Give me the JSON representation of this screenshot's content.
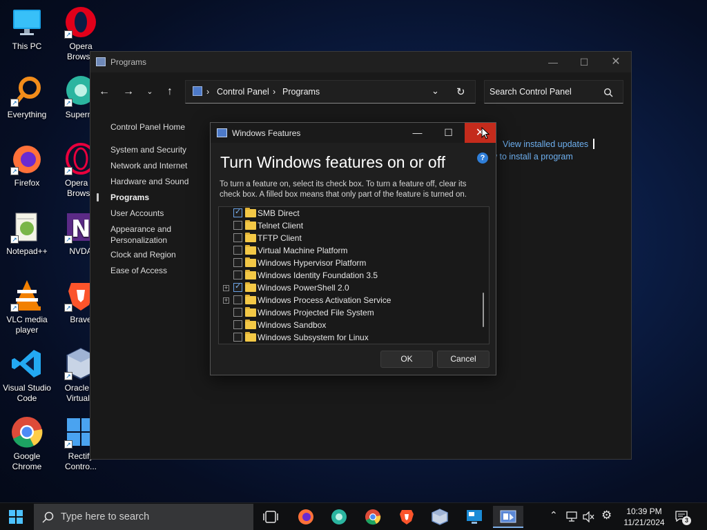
{
  "desktop": {
    "icons": [
      {
        "label": "This PC",
        "icon": "monitor-icon"
      },
      {
        "label": "Opera\nBrowse",
        "icon": "opera-icon"
      },
      {
        "label": "Everything",
        "icon": "magnifier-icon"
      },
      {
        "label": "Supermi",
        "icon": "supermium-icon"
      },
      {
        "label": "Firefox",
        "icon": "firefox-icon"
      },
      {
        "label": "Opera G\nBrowse",
        "icon": "opera-gx-icon"
      },
      {
        "label": "Notepad++",
        "icon": "notepadpp-icon"
      },
      {
        "label": "NVDA",
        "icon": "nvda-icon"
      },
      {
        "label": "VLC media\nplayer",
        "icon": "vlc-icon"
      },
      {
        "label": "Brave",
        "icon": "brave-icon"
      },
      {
        "label": "Visual Studio\nCode",
        "icon": "vscode-icon"
      },
      {
        "label": "Oracle V\nVirtualB",
        "icon": "virtualbox-icon"
      },
      {
        "label": "Google\nChrome",
        "icon": "chrome-icon"
      },
      {
        "label": "Rectify\nContro...",
        "icon": "rectify-icon"
      }
    ]
  },
  "control_panel": {
    "window_title": "Programs",
    "address": {
      "root": "Control Panel",
      "current": "Programs",
      "separator": "›"
    },
    "search_placeholder": "Search Control Panel",
    "sidebar": {
      "home": "Control Panel Home",
      "items": [
        "System and Security",
        "Network and Internet",
        "Hardware and Sound",
        "Programs",
        "User Accounts",
        "Appearance and\nPersonalization",
        "Clock and Region",
        "Ease of Access"
      ],
      "selected": "Programs"
    },
    "links": {
      "view_updates": "View installed updates",
      "install_program": "w to install a program"
    }
  },
  "windows_features": {
    "title": "Windows Features",
    "heading": "Turn Windows features on or off",
    "help": "?",
    "description": "To turn a feature on, select its check box. To turn a feature off, clear its check box. A filled box means that only part of the feature is turned on.",
    "features": [
      {
        "label": "SMB Direct",
        "checked": true,
        "expandable": false
      },
      {
        "label": "Telnet Client",
        "checked": false,
        "expandable": false
      },
      {
        "label": "TFTP Client",
        "checked": false,
        "expandable": false
      },
      {
        "label": "Virtual Machine Platform",
        "checked": false,
        "expandable": false
      },
      {
        "label": "Windows Hypervisor Platform",
        "checked": false,
        "expandable": false
      },
      {
        "label": "Windows Identity Foundation 3.5",
        "checked": false,
        "expandable": false
      },
      {
        "label": "Windows PowerShell 2.0",
        "checked": true,
        "expandable": true
      },
      {
        "label": "Windows Process Activation Service",
        "checked": false,
        "expandable": true
      },
      {
        "label": "Windows Projected File System",
        "checked": false,
        "expandable": false
      },
      {
        "label": "Windows Sandbox",
        "checked": false,
        "expandable": false
      },
      {
        "label": "Windows Subsystem for Linux",
        "checked": false,
        "expandable": false
      }
    ],
    "ok_label": "OK",
    "cancel_label": "Cancel"
  },
  "taskbar": {
    "search_placeholder": "Type here to search",
    "clock_time": "10:39 PM",
    "clock_date": "11/21/2024",
    "notification_count": "3",
    "apps": [
      "task-view-icon",
      "firefox-icon",
      "supermium-icon",
      "chrome-icon",
      "brave-icon",
      "virtualbox-icon",
      "rdp-icon",
      "control-panel-icon"
    ]
  },
  "colors": {
    "accent": "#0078d4",
    "close_red": "#c42b1c",
    "link": "#6eb0f0"
  }
}
